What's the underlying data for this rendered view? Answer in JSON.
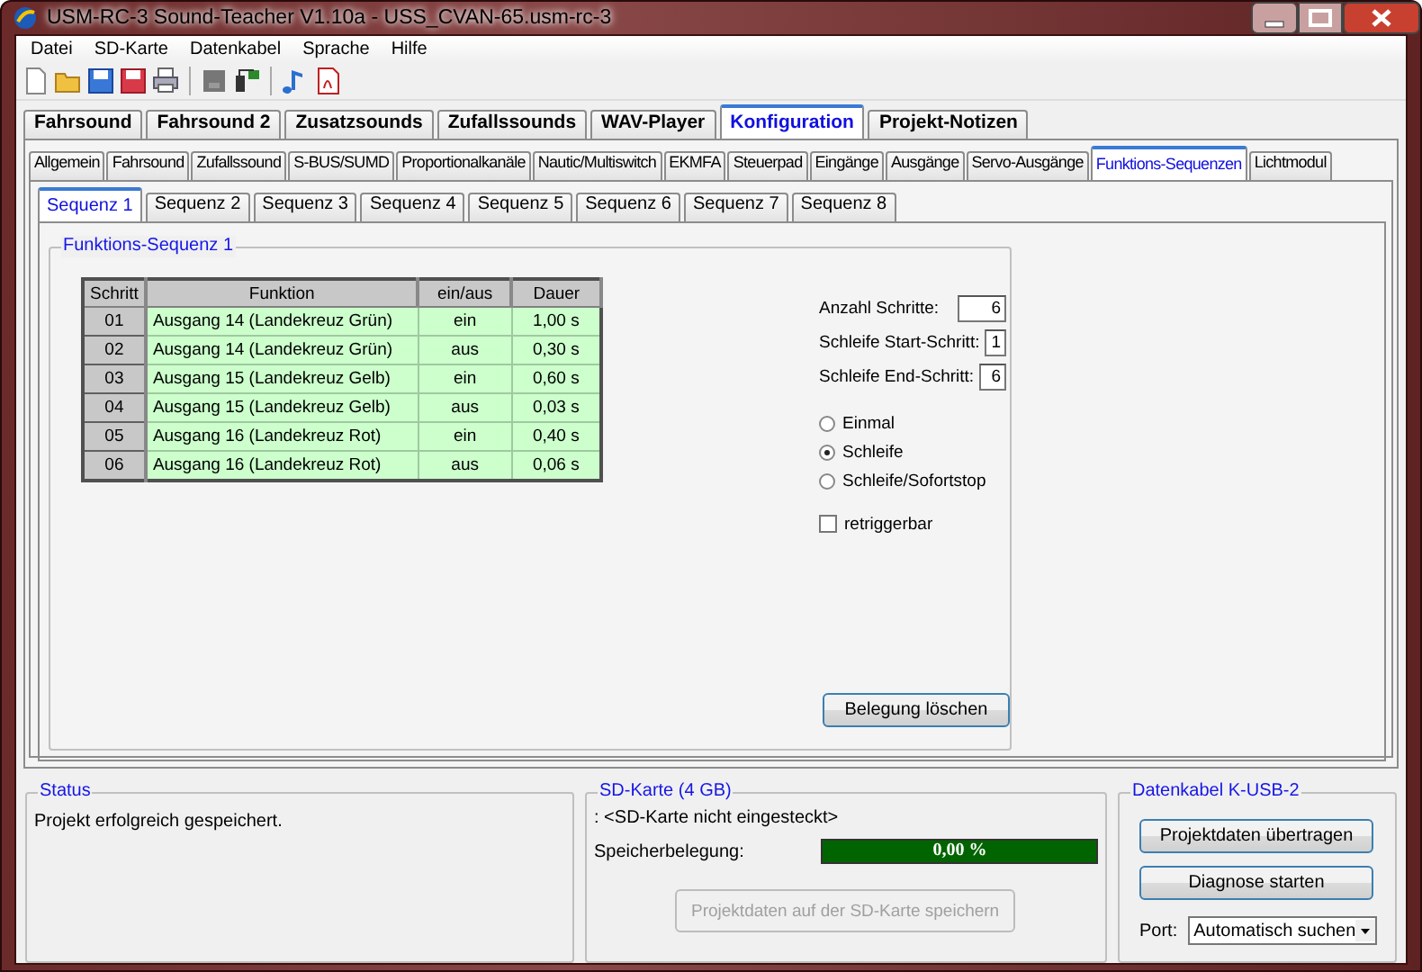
{
  "window": {
    "title": "USM-RC-3 Sound-Teacher V1.10a - USS_CVAN-65.usm-rc-3"
  },
  "menu": [
    "Datei",
    "SD-Karte",
    "Datenkabel",
    "Sprache",
    "Hilfe"
  ],
  "tabs_main": [
    {
      "label": "Fahrsound",
      "selected": false
    },
    {
      "label": "Fahrsound 2",
      "selected": false
    },
    {
      "label": "Zusatzsounds",
      "selected": false
    },
    {
      "label": "Zufallssounds",
      "selected": false
    },
    {
      "label": "WAV-Player",
      "selected": false
    },
    {
      "label": "Konfiguration",
      "selected": true
    },
    {
      "label": "Projekt-Notizen",
      "selected": false
    }
  ],
  "tabs_config": [
    {
      "label": "Allgemein",
      "selected": false
    },
    {
      "label": "Fahrsound",
      "selected": false
    },
    {
      "label": "Zufallssound",
      "selected": false
    },
    {
      "label": "S-BUS/SUMD",
      "selected": false
    },
    {
      "label": "Proportionalkanäle",
      "selected": false
    },
    {
      "label": "Nautic/Multiswitch",
      "selected": false
    },
    {
      "label": "EKMFA",
      "selected": false
    },
    {
      "label": "Steuerpad",
      "selected": false
    },
    {
      "label": "Eingänge",
      "selected": false
    },
    {
      "label": "Ausgänge",
      "selected": false
    },
    {
      "label": "Servo-Ausgänge",
      "selected": false
    },
    {
      "label": "Funktions-Sequenzen",
      "selected": true
    },
    {
      "label": "Lichtmodul",
      "selected": false
    }
  ],
  "tabs_sequence": [
    {
      "label": "Sequenz 1",
      "selected": true
    },
    {
      "label": "Sequenz 2",
      "selected": false
    },
    {
      "label": "Sequenz 3",
      "selected": false
    },
    {
      "label": "Sequenz 4",
      "selected": false
    },
    {
      "label": "Sequenz 5",
      "selected": false
    },
    {
      "label": "Sequenz 6",
      "selected": false
    },
    {
      "label": "Sequenz 7",
      "selected": false
    },
    {
      "label": "Sequenz 8",
      "selected": false
    }
  ],
  "sequence": {
    "title": "Funktions-Sequenz 1",
    "table": {
      "columns": [
        "Schritt",
        "Funktion",
        "ein/aus",
        "Dauer"
      ],
      "rows": [
        [
          "01",
          "Ausgang 14 (Landekreuz Grün)",
          "ein",
          "1,00 s"
        ],
        [
          "02",
          "Ausgang 14 (Landekreuz Grün)",
          "aus",
          "0,30 s"
        ],
        [
          "03",
          "Ausgang 15 (Landekreuz Gelb)",
          "ein",
          "0,60 s"
        ],
        [
          "04",
          "Ausgang 15 (Landekreuz Gelb)",
          "aus",
          "0,03 s"
        ],
        [
          "05",
          "Ausgang 16 (Landekreuz Rot)",
          "ein",
          "0,40 s"
        ],
        [
          "06",
          "Ausgang 16 (Landekreuz Rot)",
          "aus",
          "0,06 s"
        ]
      ]
    },
    "fields": [
      {
        "label": "Anzahl Schritte:",
        "value": "6"
      },
      {
        "label": "Schleife Start-Schritt:",
        "value": "1"
      },
      {
        "label": "Schleife End-Schritt:",
        "value": "6"
      }
    ],
    "modes": [
      {
        "label": "Einmal",
        "selected": false
      },
      {
        "label": "Schleife",
        "selected": true
      },
      {
        "label": "Schleife/Sofortstop",
        "selected": false
      }
    ],
    "retrigger": {
      "label": "retriggerbar",
      "checked": false
    },
    "clear_button": "Belegung löschen"
  },
  "status": {
    "title": "Status",
    "message": "Projekt erfolgreich gespeichert."
  },
  "sd_card": {
    "title": "SD-Karte (4 GB)",
    "info": ": <SD-Karte nicht eingesteckt>",
    "usage_label": "Speicherbelegung:",
    "usage_reading": "0,00 %",
    "save_button": {
      "label": "Projektdaten auf der SD-Karte speichern",
      "disabled": true
    }
  },
  "cable": {
    "title": "Datenkabel K-USB-2",
    "buttons": [
      "Projektdaten übertragen",
      "Diagnose starten"
    ],
    "port_label": "Port:",
    "port_value": "Automatisch suchen"
  }
}
